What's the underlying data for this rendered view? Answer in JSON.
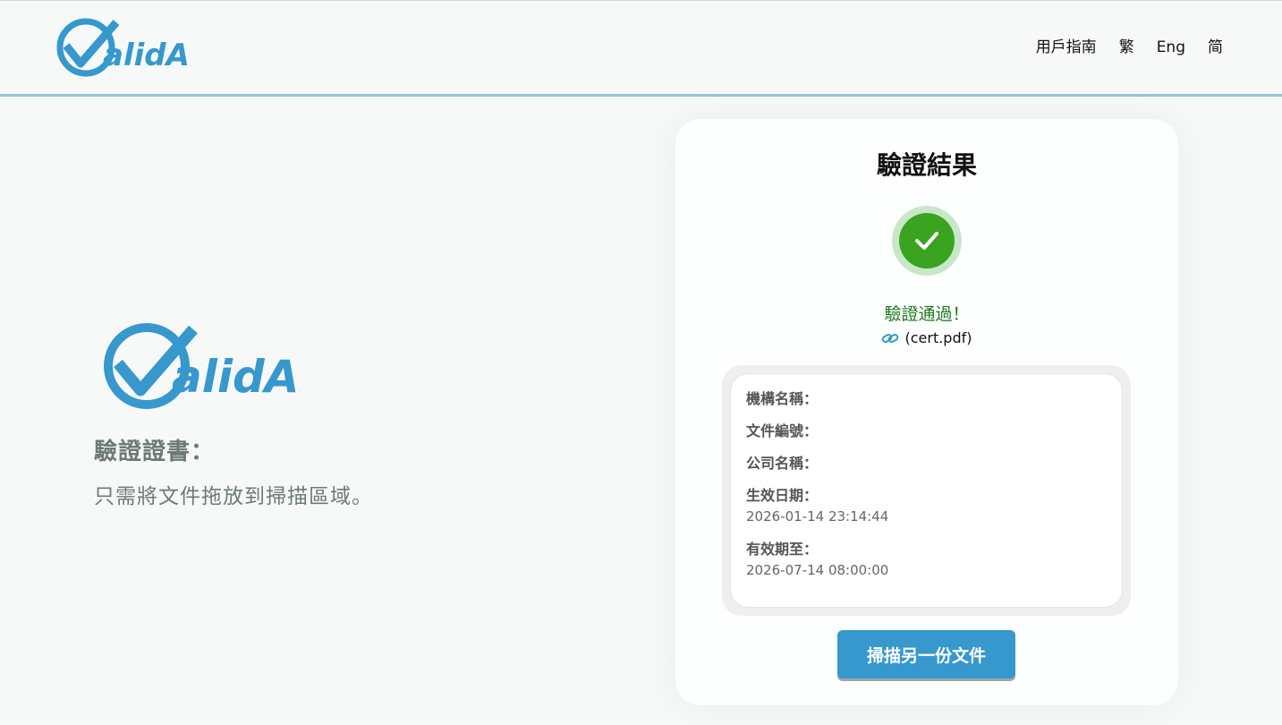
{
  "header": {
    "logo_alt": "ValidAP",
    "nav": [
      "用戶指南",
      "繁",
      "Eng",
      "简"
    ]
  },
  "hero": {
    "logo_alt": "ValidAP",
    "title": "驗證證書：",
    "description": "只需將文件拖放到掃描區域。"
  },
  "result": {
    "title": "驗證結果",
    "status_icon": "check-circle-icon",
    "status_text": "驗證通過！",
    "file_icon": "link-icon",
    "file_name": "(cert.pdf)",
    "fields": {
      "org_name_label": "機構名稱：",
      "doc_number_label": "文件編號：",
      "company_name_label": "公司名稱：",
      "effective_date_label": "生效日期：",
      "effective_date_value": "2026-01-14 23:14:44",
      "valid_until_label": "有效期至：",
      "valid_until_value": "2026-07-14 08:00:00"
    },
    "scan_again_label": "掃描另一份文件"
  },
  "colors": {
    "brand_blue": "#3698cc",
    "success_green": "#3aa31f",
    "success_text": "#1e7a1e",
    "header_border": "#8fc5d8"
  }
}
